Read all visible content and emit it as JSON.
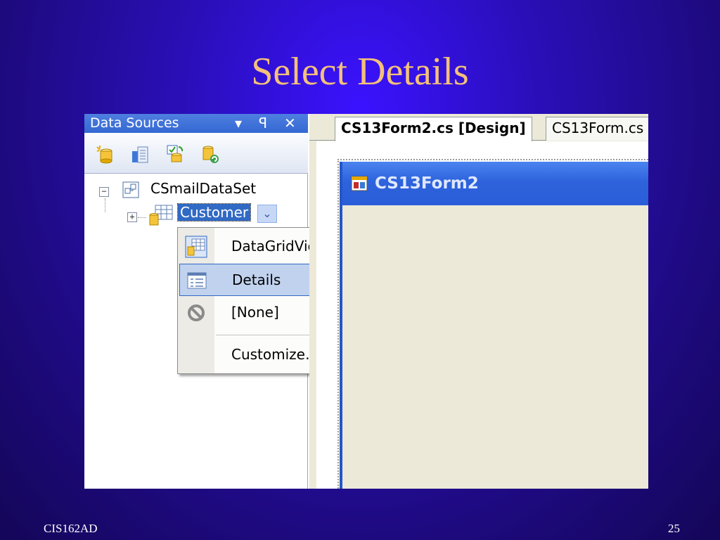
{
  "slide": {
    "title": "Select Details",
    "footer_left": "CIS162AD",
    "footer_right": "25"
  },
  "data_sources": {
    "title": "Data Sources",
    "header_buttons": {
      "dropdown": "▾",
      "pin": "ꟼ",
      "close": "✕"
    },
    "toolbar_icons": [
      "add-data-source-icon",
      "edit-dataset-designer-icon",
      "configure-dataset-icon",
      "refresh-icon"
    ],
    "tree": {
      "dataset": "CSmailDataSet",
      "table": "Customer",
      "collapse_glyph": "−",
      "expand_glyph": "+"
    }
  },
  "dropdown_menu": {
    "items": [
      {
        "label": "DataGridView",
        "icon": "datagridview-icon"
      },
      {
        "label": "Details",
        "icon": "details-icon",
        "highlighted": true
      },
      {
        "label": "[None]",
        "icon": "none-icon"
      },
      {
        "label": "Customize…",
        "icon": ""
      }
    ]
  },
  "designer": {
    "tabs": [
      {
        "label": "CS13Form2.cs [Design]",
        "active": true
      },
      {
        "label": "CS13Form.cs",
        "active": false
      }
    ],
    "form_title": "CS13Form2"
  },
  "colors": {
    "slide_title": "#f4c07a",
    "selection": "#316ac5",
    "menu_highlight": "#c1d2ee",
    "form_titlebar": "#2e63dc"
  }
}
